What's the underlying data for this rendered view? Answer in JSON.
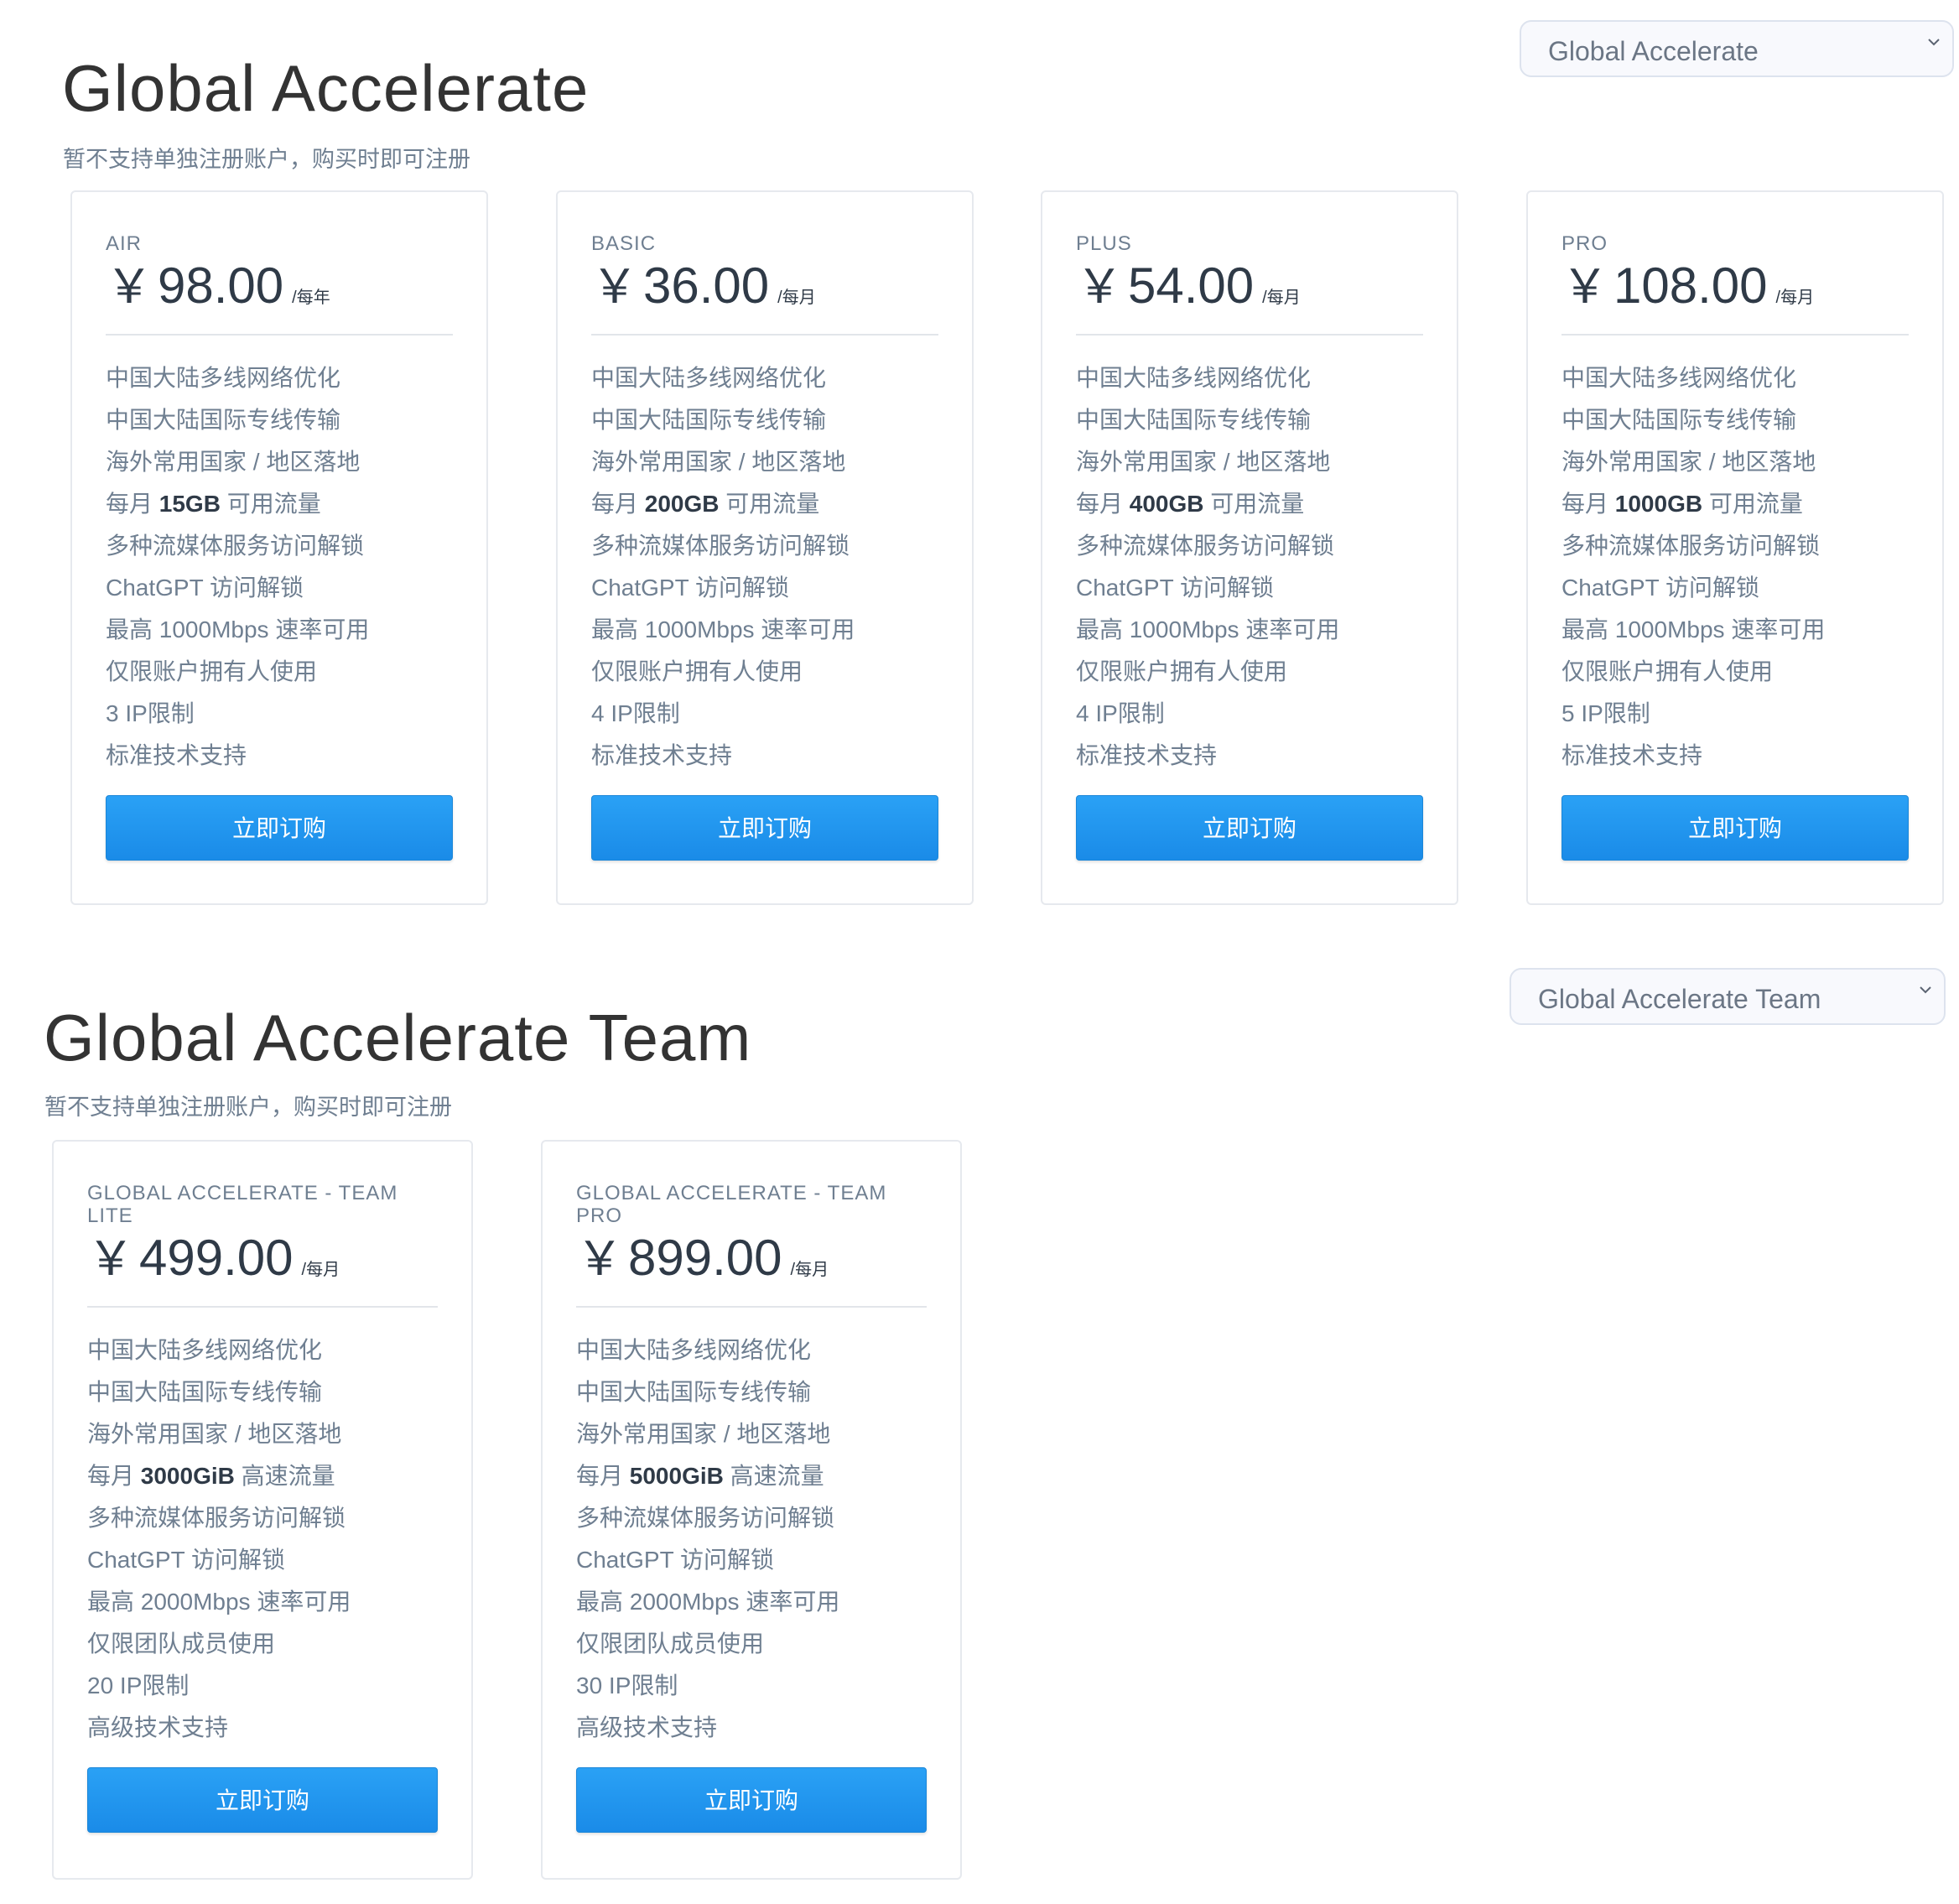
{
  "sections": [
    {
      "title": "Global Accelerate",
      "subtitle": "暂不支持单独注册账户，购买时即可注册",
      "selector": "Global Accelerate",
      "plans": [
        {
          "name": "AIR",
          "currency": "￥",
          "price": "98.00",
          "period": "/每年",
          "features": [
            "中国大陆多线网络优化",
            "中国大陆国际专线传输",
            "海外常用国家 / 地区落地",
            {
              "pre": "每月 ",
              "bold": "15GB",
              "post": " 可用流量"
            },
            "多种流媒体服务访问解锁",
            "ChatGPT 访问解锁",
            "最高 1000Mbps 速率可用",
            "仅限账户拥有人使用",
            "3 IP限制",
            "标准技术支持"
          ],
          "button": "立即订购"
        },
        {
          "name": "BASIC",
          "currency": "￥",
          "price": "36.00",
          "period": "/每月",
          "features": [
            "中国大陆多线网络优化",
            "中国大陆国际专线传输",
            "海外常用国家 / 地区落地",
            {
              "pre": "每月 ",
              "bold": "200GB",
              "post": " 可用流量"
            },
            "多种流媒体服务访问解锁",
            "ChatGPT 访问解锁",
            "最高 1000Mbps 速率可用",
            "仅限账户拥有人使用",
            "4 IP限制",
            "标准技术支持"
          ],
          "button": "立即订购"
        },
        {
          "name": "PLUS",
          "currency": "￥",
          "price": "54.00",
          "period": "/每月",
          "features": [
            "中国大陆多线网络优化",
            "中国大陆国际专线传输",
            "海外常用国家 / 地区落地",
            {
              "pre": "每月 ",
              "bold": "400GB",
              "post": " 可用流量"
            },
            "多种流媒体服务访问解锁",
            "ChatGPT 访问解锁",
            "最高 1000Mbps 速率可用",
            "仅限账户拥有人使用",
            "4 IP限制",
            "标准技术支持"
          ],
          "button": "立即订购"
        },
        {
          "name": "PRO",
          "currency": "￥",
          "price": "108.00",
          "period": "/每月",
          "features": [
            "中国大陆多线网络优化",
            "中国大陆国际专线传输",
            "海外常用国家 / 地区落地",
            {
              "pre": "每月 ",
              "bold": "1000GB",
              "post": " 可用流量"
            },
            "多种流媒体服务访问解锁",
            "ChatGPT 访问解锁",
            "最高 1000Mbps 速率可用",
            "仅限账户拥有人使用",
            "5 IP限制",
            "标准技术支持"
          ],
          "button": "立即订购"
        }
      ]
    },
    {
      "title": "Global Accelerate Team",
      "subtitle": "暂不支持单独注册账户，购买时即可注册",
      "selector": "Global Accelerate Team",
      "plans": [
        {
          "name": "GLOBAL ACCELERATE - TEAM LITE",
          "currency": "￥",
          "price": "499.00",
          "period": "/每月",
          "features": [
            "中国大陆多线网络优化",
            "中国大陆国际专线传输",
            "海外常用国家 / 地区落地",
            {
              "pre": "每月 ",
              "bold": "3000GiB",
              "post": " 高速流量"
            },
            "多种流媒体服务访问解锁",
            "ChatGPT 访问解锁",
            "最高 2000Mbps 速率可用",
            "仅限团队成员使用",
            "20 IP限制",
            "高级技术支持"
          ],
          "button": "立即订购"
        },
        {
          "name": "GLOBAL ACCELERATE - TEAM PRO",
          "currency": "￥",
          "price": "899.00",
          "period": "/每月",
          "features": [
            "中国大陆多线网络优化",
            "中国大陆国际专线传输",
            "海外常用国家 / 地区落地",
            {
              "pre": "每月 ",
              "bold": "5000GiB",
              "post": " 高速流量"
            },
            "多种流媒体服务访问解锁",
            "ChatGPT 访问解锁",
            "最高 2000Mbps 速率可用",
            "仅限团队成员使用",
            "30 IP限制",
            "高级技术支持"
          ],
          "button": "立即订购"
        }
      ]
    }
  ]
}
